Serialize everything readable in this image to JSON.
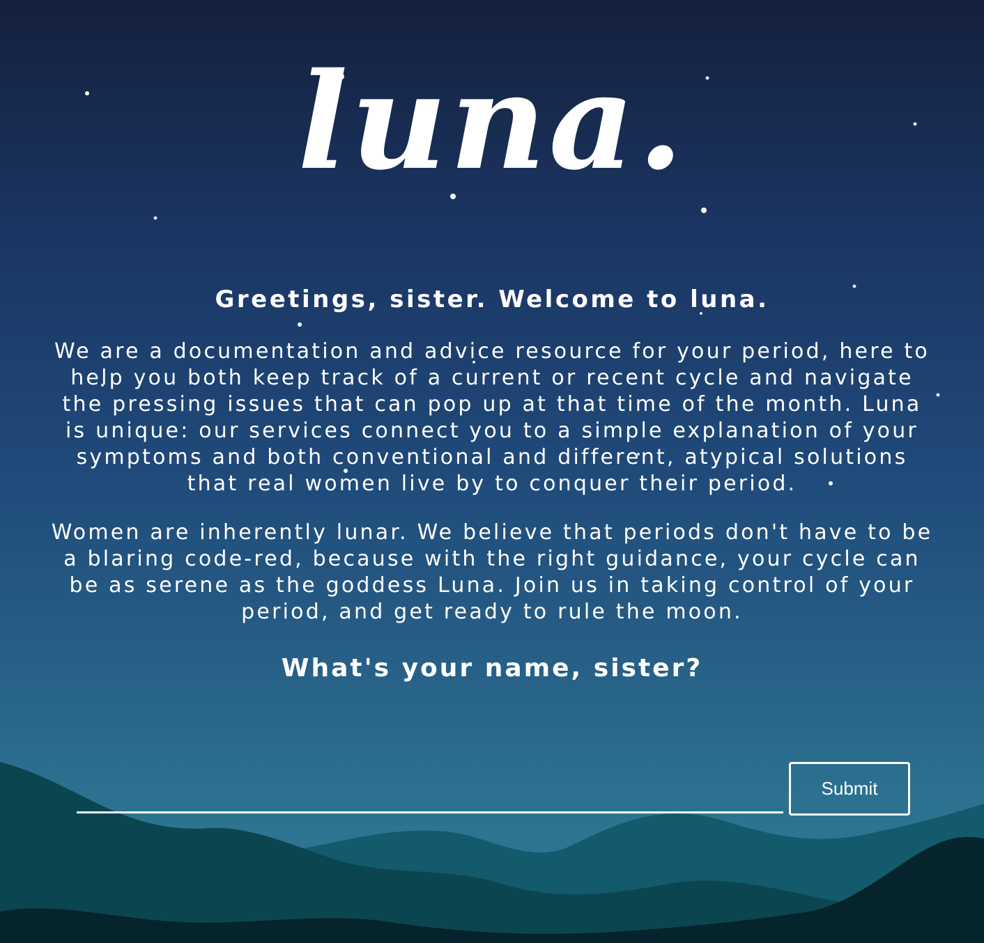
{
  "brand": {
    "logo_text": "luna."
  },
  "intro": {
    "greeting": "Greetings, sister. Welcome to luna.",
    "paragraph_1": "We are a documentation and advice resource for your period, here to help you both keep track of a current or recent cycle and navigate the pressing issues that can pop up at that time of the month. Luna is unique: our services connect you to a simple explanation of your symptoms and both conventional and different, atypical solutions that real women live by to conquer their period.",
    "paragraph_2": "Women are inherently lunar. We believe that periods don't have to be a blaring code-red, because with the right guidance, your cycle can be as serene as the goddess Luna. Join us in taking control of your period, and get ready to rule the moon."
  },
  "form": {
    "question": "What's your name, sister?",
    "name_value": "",
    "name_placeholder": "",
    "submit_label": "Submit"
  },
  "colors": {
    "sky_top": "#14213d",
    "sky_bottom": "#2d7a92",
    "mountain_far": "#125a6c",
    "mountain_mid": "#0b4550",
    "mountain_near": "#06242b"
  }
}
